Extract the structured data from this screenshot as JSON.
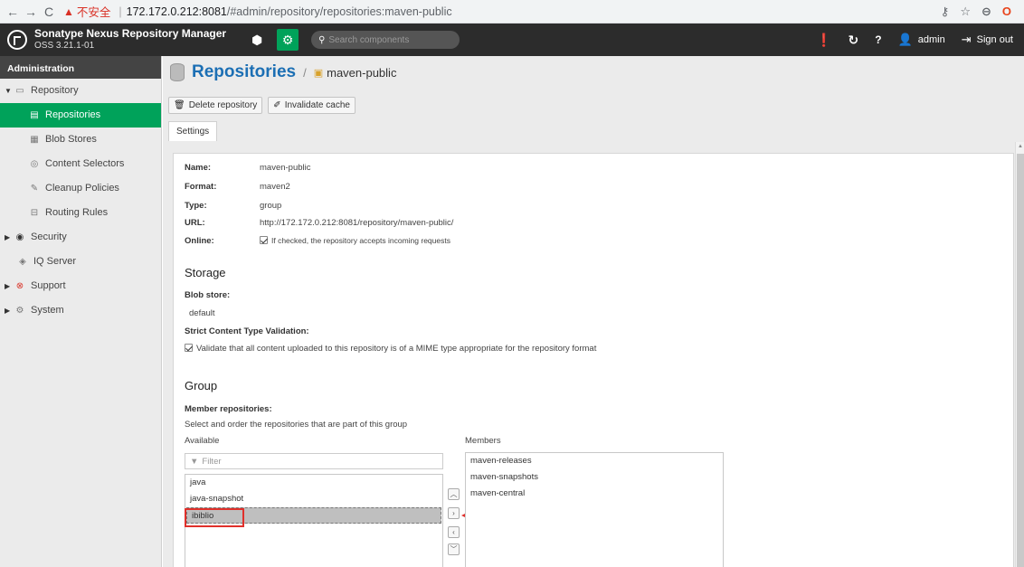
{
  "browser": {
    "back": "←",
    "forward": "→",
    "reload": "C",
    "insecure_label": "不安全",
    "host": "172.172.0.212:8081",
    "path": "/#admin/repository/repositories:maven-public"
  },
  "header": {
    "title": "Sonatype Nexus Repository Manager",
    "version": "OSS 3.21.1-01",
    "search_placeholder": "Search components",
    "user": "admin",
    "sign_out": "Sign out"
  },
  "sidebar": {
    "heading": "Administration",
    "items": [
      {
        "label": "Repository"
      },
      {
        "label": "Repositories"
      },
      {
        "label": "Blob Stores"
      },
      {
        "label": "Content Selectors"
      },
      {
        "label": "Cleanup Policies"
      },
      {
        "label": "Routing Rules"
      },
      {
        "label": "Security"
      },
      {
        "label": "IQ Server"
      },
      {
        "label": "Support"
      },
      {
        "label": "System"
      }
    ]
  },
  "page": {
    "title": "Repositories",
    "breadcrumb_sep": "/",
    "current": "maven-public",
    "buttons": {
      "delete": "Delete repository",
      "invalidate": "Invalidate cache"
    },
    "tab": "Settings"
  },
  "settings": {
    "name_label": "Name:",
    "name": "maven-public",
    "format_label": "Format:",
    "format": "maven2",
    "type_label": "Type:",
    "type": "group",
    "url_label": "URL:",
    "url": "http://172.172.0.212:8081/repository/maven-public/",
    "online_label": "Online:",
    "online_note": "If checked, the repository accepts incoming requests",
    "storage_title": "Storage",
    "blob_label": "Blob store:",
    "blob": "default",
    "strict_label": "Strict Content Type Validation:",
    "strict_note": "Validate that all content uploaded to this repository is of a MIME type appropriate for the repository format",
    "group_title": "Group",
    "member_label": "Member repositories:",
    "member_help": "Select and order the repositories that are part of this group",
    "available_label": "Available",
    "members_label": "Members",
    "filter_placeholder": "Filter",
    "available": [
      "java",
      "java-snapshot",
      "ibiblio"
    ],
    "members": [
      "maven-releases",
      "maven-snapshots",
      "maven-central"
    ]
  },
  "colors": {
    "accent": "#00a25a",
    "title_blue": "#1c6fb4",
    "header_bg": "#2c2c2c",
    "highlight_red": "#e0302b"
  }
}
